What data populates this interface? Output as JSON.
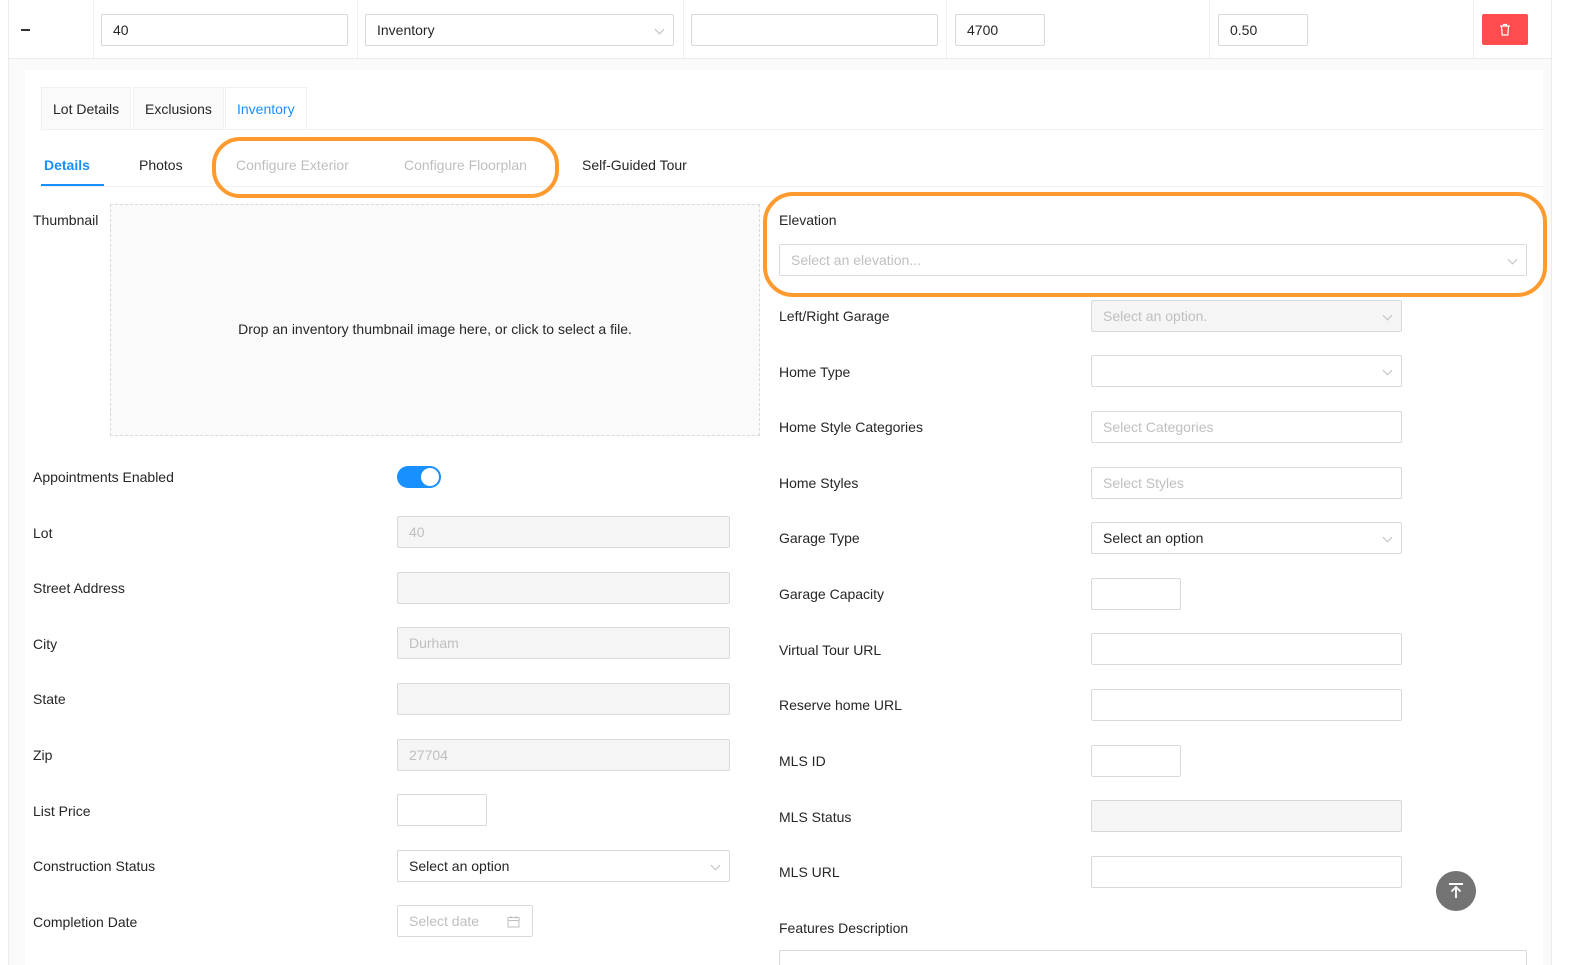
{
  "top_row": {
    "lot_value": "40",
    "type_value": "Inventory",
    "name_value": "",
    "price_value": "4700",
    "acreage_value": "0.50"
  },
  "tabs_primary": [
    "Lot Details",
    "Exclusions",
    "Inventory"
  ],
  "tabs_secondary": [
    "Details",
    "Photos",
    "Configure Exterior",
    "Configure Floorplan",
    "Self-Guided Tour"
  ],
  "thumbnail": {
    "label": "Thumbnail",
    "dropzone_text": "Drop an inventory thumbnail image here, or click to select a file."
  },
  "left_form": {
    "appointments_label": "Appointments Enabled",
    "appointments_enabled": true,
    "lot_label": "Lot",
    "lot_value": "40",
    "street_label": "Street Address",
    "street_value": "",
    "city_label": "City",
    "city_value": "Durham",
    "state_label": "State",
    "state_value": "",
    "zip_label": "Zip",
    "zip_value": "27704",
    "list_price_label": "List Price",
    "list_price_value": "",
    "construction_label": "Construction Status",
    "construction_value": "Select an option",
    "completion_label": "Completion Date",
    "completion_placeholder": "Select date"
  },
  "right_form": {
    "elevation_label": "Elevation",
    "elevation_placeholder": "Select an elevation...",
    "garage_side_label": "Left/Right Garage",
    "garage_side_placeholder": "Select an option.",
    "home_type_label": "Home Type",
    "home_type_value": "",
    "style_categories_label": "Home Style Categories",
    "style_categories_placeholder": "Select Categories",
    "home_styles_label": "Home Styles",
    "home_styles_placeholder": "Select Styles",
    "garage_type_label": "Garage Type",
    "garage_type_value": "Select an option",
    "garage_capacity_label": "Garage Capacity",
    "virtual_tour_label": "Virtual Tour URL",
    "reserve_label": "Reserve home URL",
    "mls_id_label": "MLS ID",
    "mls_status_label": "MLS Status",
    "mls_url_label": "MLS URL",
    "features_label": "Features Description"
  },
  "colors": {
    "primary": "#1890ff",
    "danger": "#ff4d4f",
    "highlight": "#ff9a2e"
  },
  "icons": [
    "minus-icon",
    "chevron-down-icon",
    "trash-icon",
    "calendar-icon",
    "arrow-up-to-top-icon"
  ]
}
